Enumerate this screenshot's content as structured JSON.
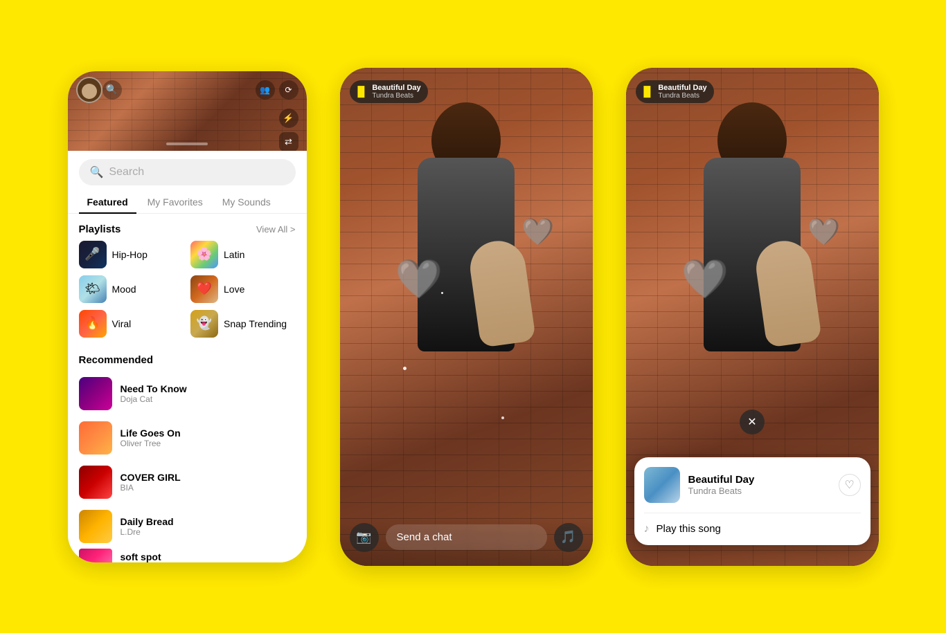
{
  "background_color": "#FFE800",
  "phone1": {
    "search": {
      "placeholder": "Search"
    },
    "tabs": [
      {
        "id": "featured",
        "label": "Featured",
        "active": true
      },
      {
        "id": "my-favorites",
        "label": "My Favorites",
        "active": false
      },
      {
        "id": "my-sounds",
        "label": "My Sounds",
        "active": false
      }
    ],
    "playlists": {
      "section_title": "Playlists",
      "view_all": "View All >",
      "items": [
        {
          "id": "hip-hop",
          "name": "Hip-Hop",
          "icon": "🎤"
        },
        {
          "id": "latin",
          "name": "Latin",
          "icon": "🌈"
        },
        {
          "id": "mood",
          "name": "Mood",
          "icon": "🌤"
        },
        {
          "id": "love",
          "name": "Love",
          "icon": "❤"
        },
        {
          "id": "viral",
          "name": "Viral",
          "icon": "🔥"
        },
        {
          "id": "snap-trending",
          "name": "Snap Trending",
          "icon": "👻"
        }
      ]
    },
    "recommended": {
      "section_title": "Recommended",
      "items": [
        {
          "id": "need-to-know",
          "title": "Need To Know",
          "artist": "Doja Cat"
        },
        {
          "id": "life-goes-on",
          "title": "Life Goes On",
          "artist": "Oliver Tree"
        },
        {
          "id": "cover-girl",
          "title": "COVER GIRL",
          "artist": "BIA"
        },
        {
          "id": "daily-bread",
          "title": "Daily Bread",
          "artist": "L.Dre"
        },
        {
          "id": "soft-spot",
          "title": "soft spot",
          "artist": ""
        }
      ]
    }
  },
  "phone2": {
    "music_badge": {
      "title": "Beautiful Day",
      "artist": "Tundra Beats"
    },
    "bottom_bar": {
      "send_chat_placeholder": "Send a chat"
    }
  },
  "phone3": {
    "music_badge": {
      "title": "Beautiful Day",
      "artist": "Tundra Beats"
    },
    "song_card": {
      "title": "Beautiful Day",
      "artist": "Tundra Beats",
      "play_label": "Play this song"
    }
  }
}
